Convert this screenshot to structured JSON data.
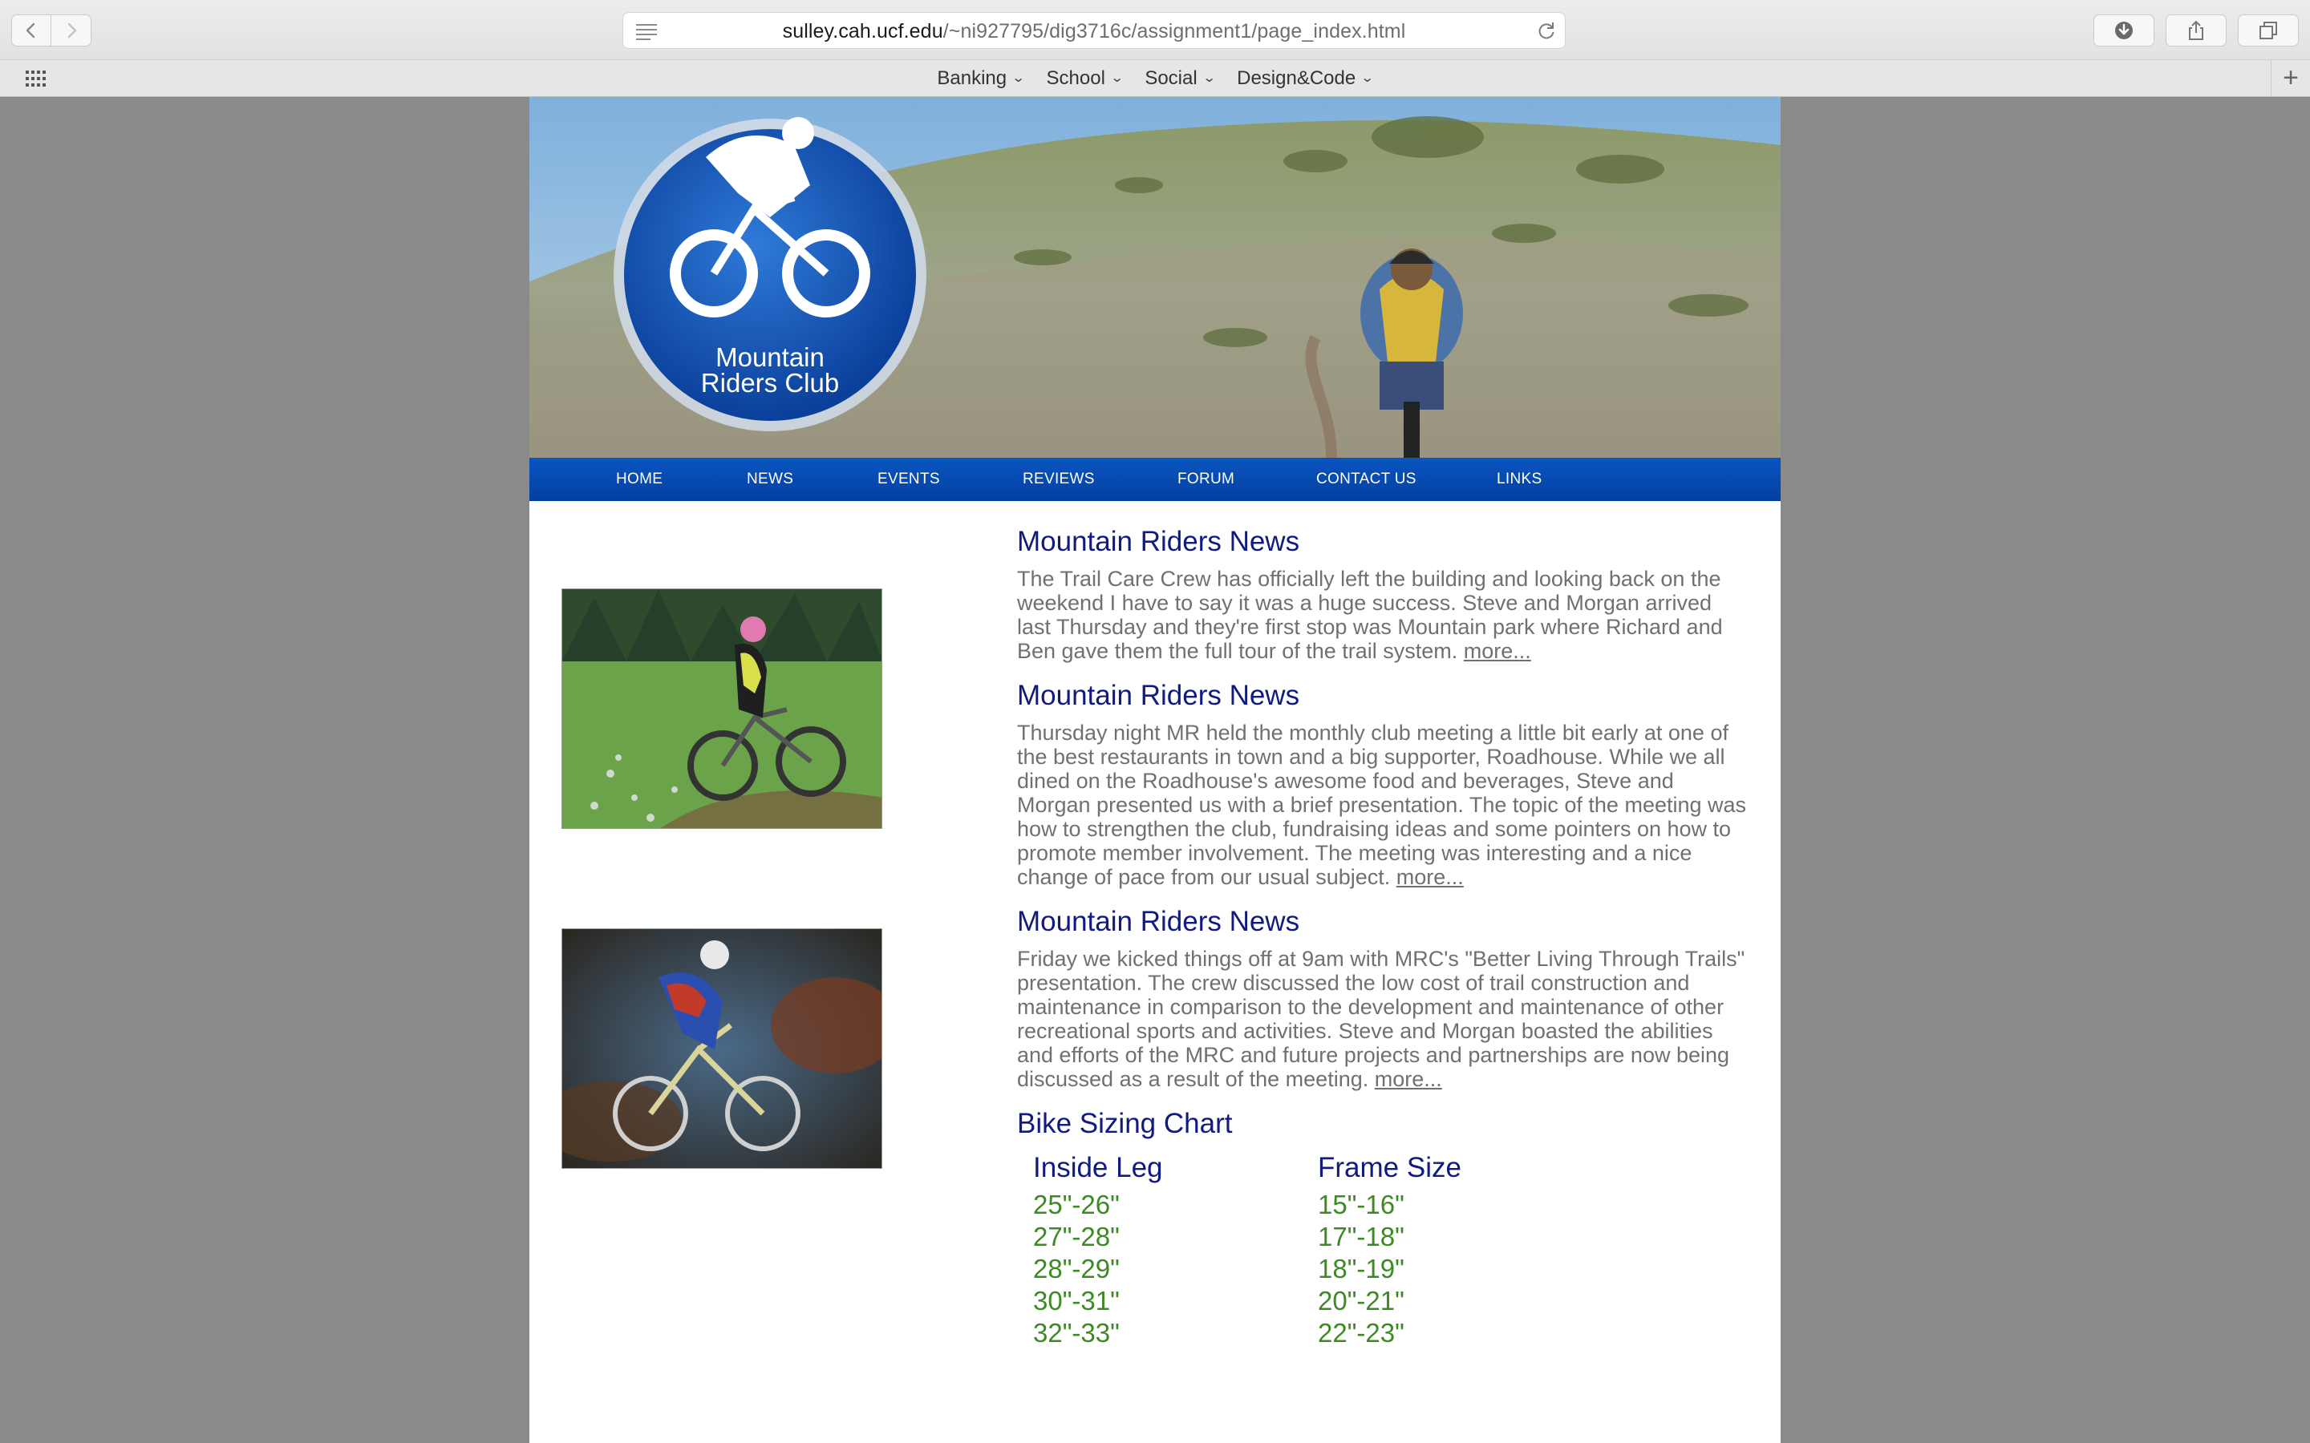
{
  "browser": {
    "url_host": "sulley.cah.ucf.edu",
    "url_path": "/~ni927795/dig3716c/assignment1/page_index.html",
    "favorites": [
      "Banking",
      "School",
      "Social",
      "Design&Code"
    ],
    "icons": [
      "back-icon",
      "forward-icon",
      "reader-icon",
      "reload-icon",
      "download-icon",
      "share-icon",
      "tabs-icon",
      "apps-grid-icon",
      "plus-icon"
    ]
  },
  "site": {
    "logo_line1": "Mountain",
    "logo_line2": "Riders Club",
    "nav": [
      "HOME",
      "NEWS",
      "EVENTS",
      "REVIEWS",
      "FORUM",
      "CONTACT US",
      "LINKS"
    ],
    "news": [
      {
        "title": "Mountain Riders News",
        "body": "The Trail Care Crew has officially left the building and looking back on the weekend I have to say it was a huge success. Steve and Morgan arrived last Thursday and they're first stop was Mountain park where Richard and Ben gave them the full tour of the trail system. ",
        "more": "more..."
      },
      {
        "title": "Mountain Riders News",
        "body": "Thursday night MR held the monthly club meeting a little bit early at one of the best restaurants in town and a big supporter, Roadhouse. While we all dined on the Roadhouse's awesome food and beverages, Steve and Morgan presented us with a brief presentation. The topic of the meeting was how to strengthen the club, fundraising ideas and some pointers on how to promote member involvement. The meeting was interesting and a nice change of pace from our usual subject. ",
        "more": "more..."
      },
      {
        "title": "Mountain Riders News",
        "body": "Friday we kicked things off at 9am with MRC's \"Better Living Through Trails\" presentation. The crew discussed the low cost of trail construction and maintenance in comparison to the development and maintenance of other recreational sports and activities. Steve and Morgan boasted the abilities and efforts of the MRC and future projects and partnerships are now being discussed as a result of the meeting. ",
        "more": "more..."
      }
    ],
    "sizing": {
      "title": "Bike Sizing Chart",
      "col1": "Inside Leg",
      "col2": "Frame Size",
      "rows": [
        [
          "25\"-26\"",
          "15\"-16\""
        ],
        [
          "27\"-28\"",
          "17\"-18\""
        ],
        [
          "28\"-29\"",
          "18\"-19\""
        ],
        [
          "30\"-31\"",
          "20\"-21\""
        ],
        [
          "32\"-33\"",
          "22\"-23\""
        ]
      ]
    }
  }
}
